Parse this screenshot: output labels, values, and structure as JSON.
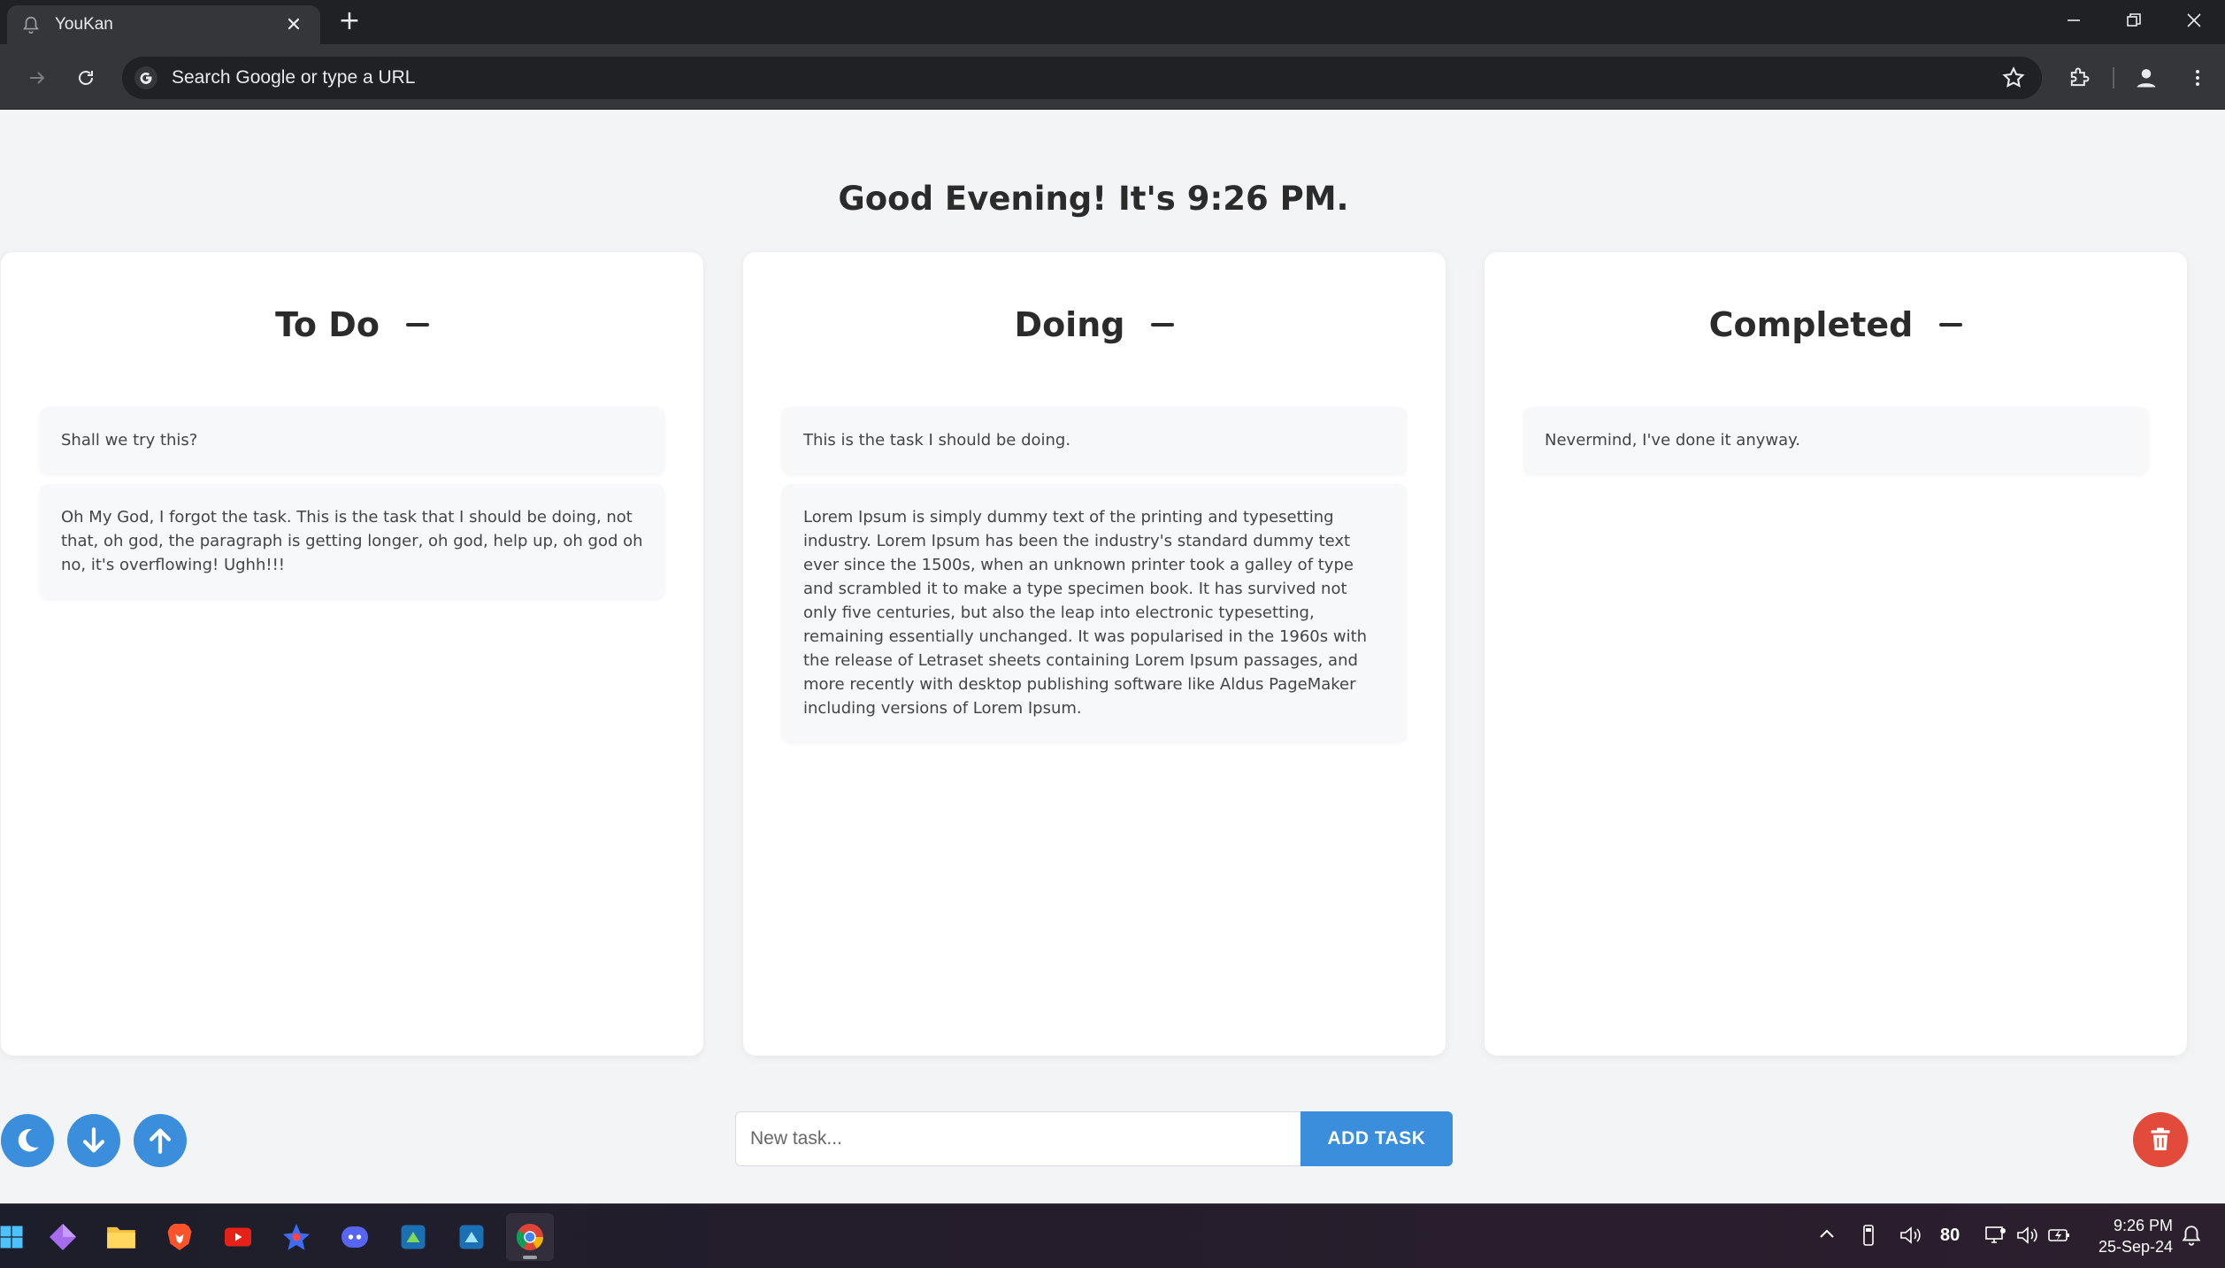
{
  "browser": {
    "tab_title": "YouKan",
    "tab_close": "✕",
    "new_tab": "+",
    "omnibox_placeholder": "Search Google or type a URL"
  },
  "page": {
    "greeting": "Good Evening! It's 9:26 PM.",
    "columns": [
      {
        "title": "To Do",
        "tasks": [
          "Shall we try this?",
          "Oh My God, I forgot the task. This is the task that I should be doing, not that, oh god, the paragraph is getting longer, oh god, help up, oh god oh no, it's overflowing! Ughh!!!"
        ]
      },
      {
        "title": "Doing",
        "tasks": [
          "This is the task I should be doing.",
          "Lorem Ipsum is simply dummy text of the printing and typesetting industry. Lorem Ipsum has been the industry's standard dummy text ever since the 1500s, when an unknown printer took a galley of type and scrambled it to make a type specimen book. It has survived not only five centuries, but also the leap into electronic typesetting, remaining essentially unchanged. It was popularised in the 1960s with the release of Letraset sheets containing Lorem Ipsum passages, and more recently with desktop publishing software like Aldus PageMaker including versions of Lorem Ipsum."
        ]
      },
      {
        "title": "Completed",
        "tasks": [
          "Nevermind, I've done it anyway."
        ]
      }
    ],
    "new_task_placeholder": "New task...",
    "add_task_label": "ADD TASK"
  },
  "colors": {
    "accent": "#3a8edb",
    "danger": "#e24a3b",
    "background": "#f3f4f6"
  },
  "taskbar": {
    "battery": "80",
    "time": "9:26 PM",
    "date": "25-Sep-24"
  }
}
